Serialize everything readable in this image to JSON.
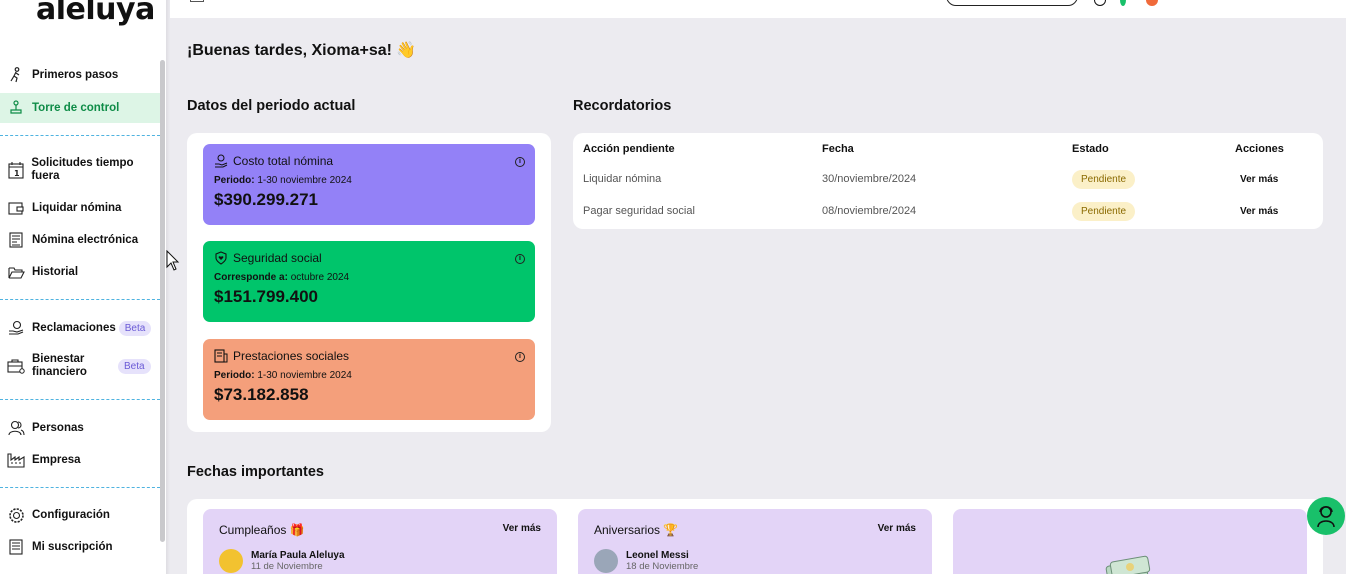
{
  "app": {
    "logo": "aleluya"
  },
  "sidebar": {
    "items": [
      {
        "label": "Primeros pasos",
        "icon": "walking-person-icon"
      },
      {
        "label": "Torre de control",
        "icon": "stamp-icon",
        "active": true
      },
      {
        "label": "Solicitudes tiempo fuera",
        "icon": "calendar-icon"
      },
      {
        "label": "Liquidar nómina",
        "icon": "wallet-icon"
      },
      {
        "label": "Nómina electrónica",
        "icon": "document-icon"
      },
      {
        "label": "Historial",
        "icon": "folder-icon"
      },
      {
        "label": "Reclamaciones",
        "icon": "hand-coin-icon",
        "badge": "Beta"
      },
      {
        "label": "Bienestar financiero",
        "icon": "briefcase-icon",
        "badge": "Beta"
      },
      {
        "label": "Personas",
        "icon": "people-icon"
      },
      {
        "label": "Empresa",
        "icon": "factory-icon"
      },
      {
        "label": "Configuración",
        "icon": "gear-icon"
      },
      {
        "label": "Mi suscripción",
        "icon": "receipt-icon"
      }
    ]
  },
  "main": {
    "greeting": "¡Buenas tardes, Xioma+sa! 👋",
    "period_title": "Datos del periodo actual",
    "kpis": [
      {
        "title": "Costo total nómina",
        "period_label": "Periodo:",
        "period_value": "1-30 noviembre 2024",
        "value": "$390.299.271",
        "color": "#9381f7",
        "icon": "hand-money-icon"
      },
      {
        "title": "Seguridad social",
        "period_label": "Corresponde a:",
        "period_value": "octubre 2024",
        "value": "$151.799.400",
        "color": "#00c56b",
        "icon": "shield-heart-icon"
      },
      {
        "title": "Prestaciones sociales",
        "period_label": "Periodo:",
        "period_value": "1-30 noviembre 2024",
        "value": "$73.182.858",
        "color": "#f49f7b",
        "icon": "receipt-icon"
      }
    ],
    "info_glyph": "i",
    "reminders": {
      "title": "Recordatorios",
      "headers": [
        "Acción pendiente",
        "Fecha",
        "Estado",
        "Acciones"
      ],
      "rows": [
        {
          "action": "Liquidar nómina",
          "date": "30/noviembre/2024",
          "status": "Pendiente",
          "link": "Ver más"
        },
        {
          "action": "Pagar seguridad social",
          "date": "08/noviembre/2024",
          "status": "Pendiente",
          "link": "Ver más"
        }
      ]
    },
    "dates": {
      "title": "Fechas importantes",
      "cards": [
        {
          "title": "Cumpleaños 🎁",
          "link": "Ver más",
          "name": "María Paula Aleluya",
          "date": "11 de Noviembre"
        },
        {
          "title": "Aniversarios 🏆",
          "link": "Ver más",
          "name": "Leonel Messi",
          "date": "18 de Noviembre"
        }
      ]
    }
  },
  "colors": {
    "accent": "#0e8c47",
    "active_bg": "#ddf5e6",
    "pending_bg": "#fbf0c8",
    "date_card": "#e3d4f7",
    "help_button": "#19c06a"
  }
}
